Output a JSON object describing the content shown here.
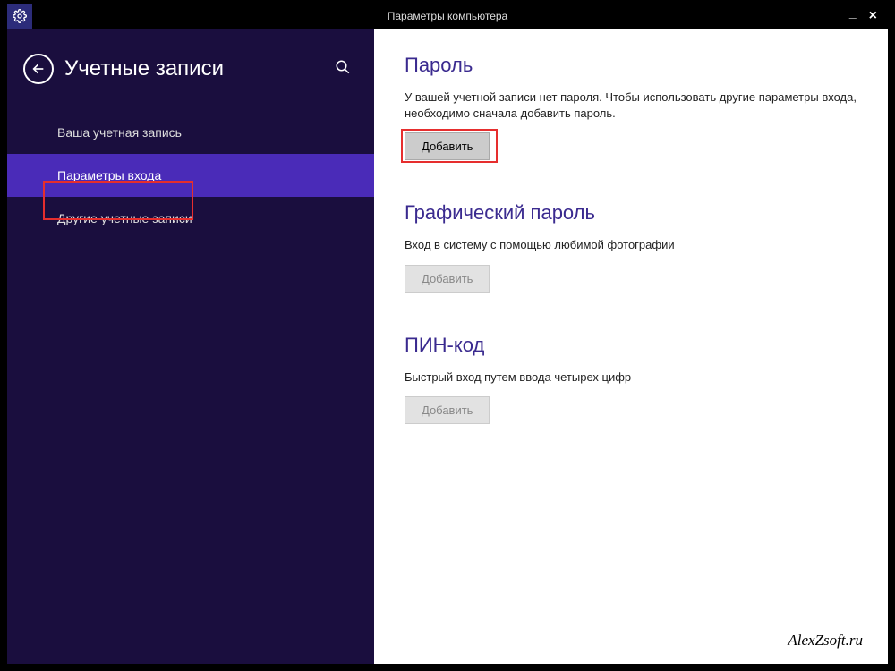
{
  "titlebar": {
    "title": "Параметры компьютера"
  },
  "sidebar": {
    "title": "Учетные записи",
    "items": [
      {
        "label": "Ваша учетная запись"
      },
      {
        "label": "Параметры входа"
      },
      {
        "label": "Другие учетные записи"
      }
    ]
  },
  "main": {
    "password": {
      "title": "Пароль",
      "desc": "У вашей учетной записи нет пароля. Чтобы использовать другие параметры входа, необходимо сначала добавить пароль.",
      "button": "Добавить"
    },
    "picture": {
      "title": "Графический пароль",
      "desc": "Вход в систему с помощью любимой фотографии",
      "button": "Добавить"
    },
    "pin": {
      "title": "ПИН-код",
      "desc": "Быстрый вход путем ввода четырех цифр",
      "button": "Добавить"
    }
  },
  "watermark": "AlexZsoft.ru"
}
